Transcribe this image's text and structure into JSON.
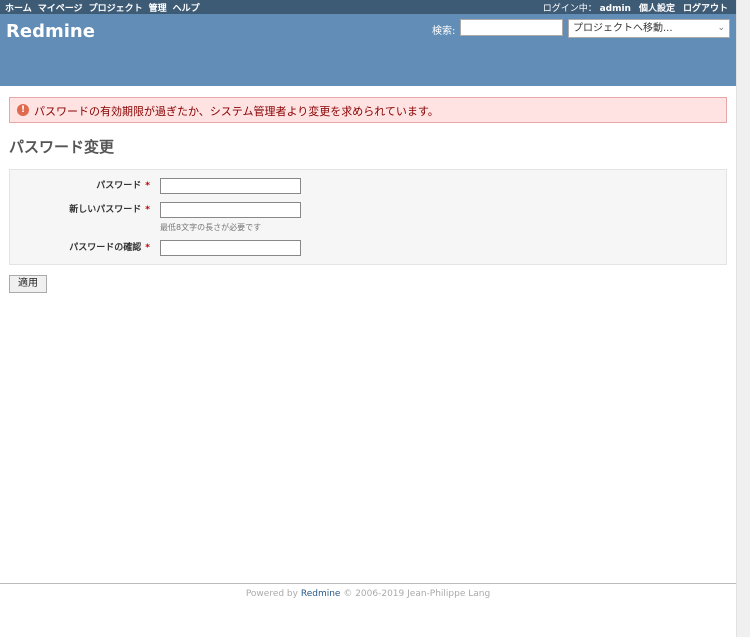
{
  "top_menu": {
    "items": [
      "ホーム",
      "マイページ",
      "プロジェクト",
      "管理",
      "ヘルプ"
    ],
    "logged_as_label": "ログイン中：",
    "user": "admin",
    "my_account": "個人設定",
    "logout": "ログアウト"
  },
  "header": {
    "title": "Redmine",
    "search_label": "検索:",
    "search_placeholder": "",
    "project_jump": "プロジェクトへ移動..."
  },
  "flash": {
    "message": "パスワードの有効期限が過ぎたか、システム管理者より変更を求められています。"
  },
  "page": {
    "title": "パスワード変更"
  },
  "form": {
    "password_label": "パスワード",
    "new_password_label": "新しいパスワード",
    "new_password_hint": "最低8文字の長さが必要です",
    "confirm_label": "パスワードの確認",
    "required_mark": "*",
    "submit_label": "適用"
  },
  "footer": {
    "powered_by": "Powered by",
    "redmine": "Redmine",
    "copyright": "© 2006-2019 Jean-Philippe Lang"
  },
  "colors": {
    "top_menu": "#3e5b76",
    "header": "#628db6",
    "flash_bg": "#ffe3e3",
    "flash_text": "#880000"
  }
}
